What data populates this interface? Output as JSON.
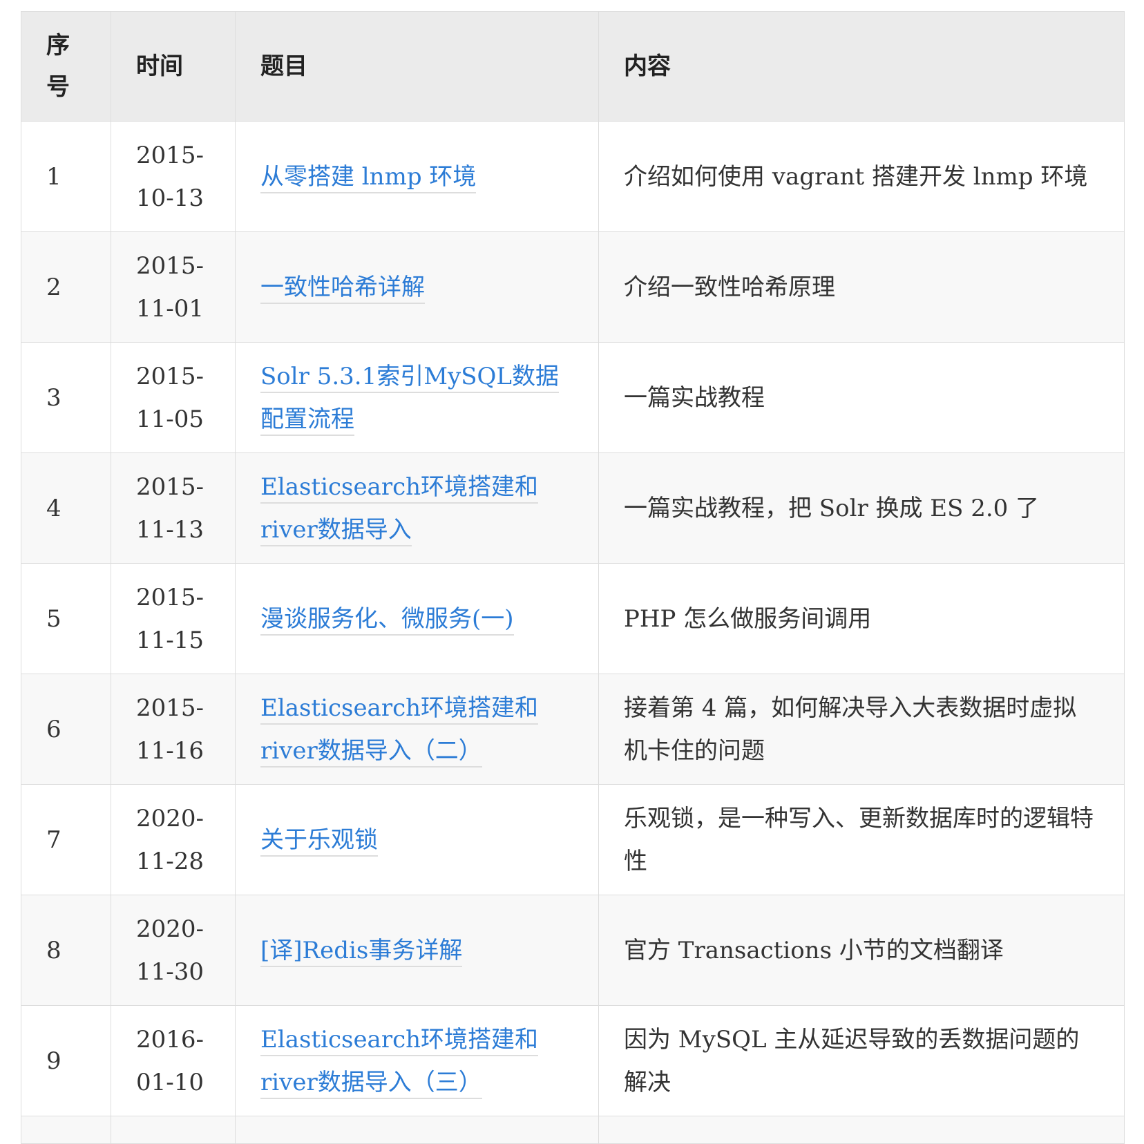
{
  "table": {
    "headers": {
      "num": "序号",
      "date": "时间",
      "title": "题目",
      "content": "内容"
    },
    "rows": [
      {
        "num": "1",
        "date": "2015-10-13",
        "title": "从零搭建 lnmp 环境",
        "content": "介绍如何使用 vagrant 搭建开发 lnmp 环境"
      },
      {
        "num": "2",
        "date": "2015-11-01",
        "title": "一致性哈希详解",
        "content": "介绍一致性哈希原理"
      },
      {
        "num": "3",
        "date": "2015-11-05",
        "title": "Solr 5.3.1索引MySQL数据配置流程",
        "content": "一篇实战教程"
      },
      {
        "num": "4",
        "date": "2015-11-13",
        "title": "Elasticsearch环境搭建和river数据导入",
        "content": "一篇实战教程，把 Solr 换成 ES 2.0 了"
      },
      {
        "num": "5",
        "date": "2015-11-15",
        "title": "漫谈服务化、微服务(一)",
        "content": "PHP 怎么做服务间调用"
      },
      {
        "num": "6",
        "date": "2015-11-16",
        "title": "Elasticsearch环境搭建和river数据导入（二）",
        "content": "接着第 4 篇，如何解决导入大表数据时虚拟机卡住的问题"
      },
      {
        "num": "7",
        "date": "2020-11-28",
        "title": "关于乐观锁",
        "content": "乐观锁，是一种写入、更新数据库时的逻辑特性"
      },
      {
        "num": "8",
        "date": "2020-11-30",
        "title": "[译]Redis事务详解",
        "content": "官方 Transactions 小节的文档翻译"
      },
      {
        "num": "9",
        "date": "2016-01-10",
        "title": "Elasticsearch环境搭建和river数据导入（三）",
        "content": "因为 MySQL 主从延迟导致的丢数据问题的解决"
      }
    ]
  }
}
